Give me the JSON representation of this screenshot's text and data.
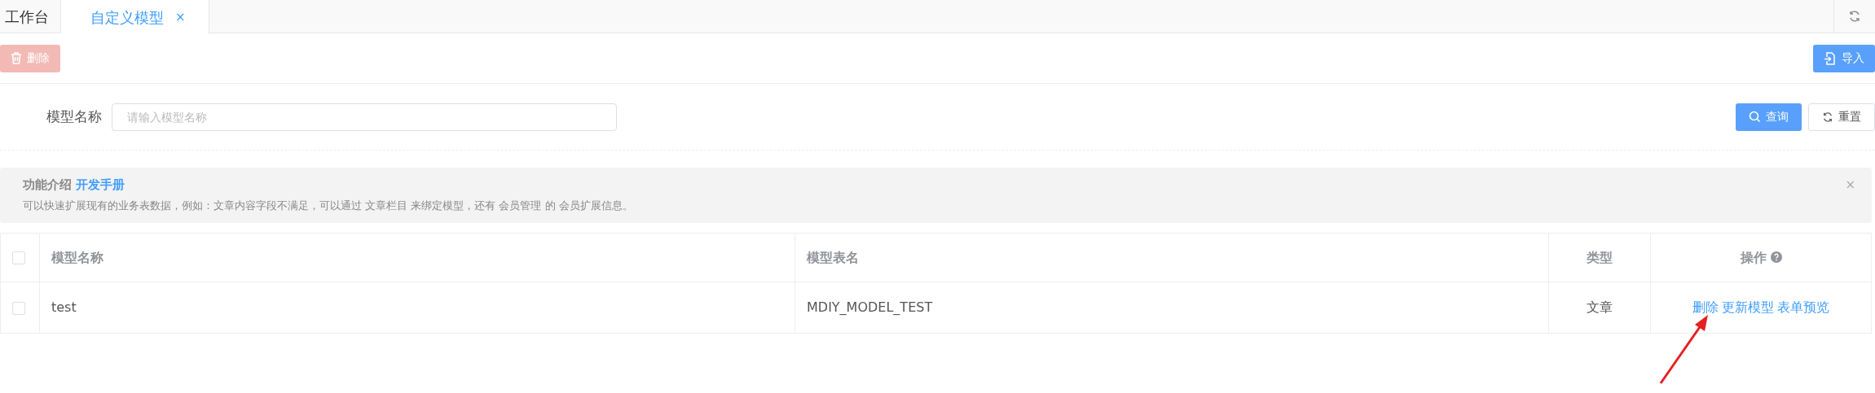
{
  "tabs": [
    {
      "label": "工作台",
      "selected": false
    },
    {
      "label": "自定义模型",
      "selected": true,
      "close": "×"
    }
  ],
  "toolbar": {
    "delete_button": {
      "label": "删除",
      "disabled": true
    },
    "import_button": {
      "label": "导入"
    }
  },
  "search": {
    "label": "模型名称",
    "placeholder": "请输入模型名称",
    "query_button": "查询",
    "reset_button": "重置"
  },
  "notice": {
    "close": "×",
    "title": "功能介绍",
    "link": "开发手册",
    "text": "可以快速扩展现有的业务表数据，例如：文章内容字段不满足，可以通过 文章栏目 来绑定模型，还有 会员管理 的 会员扩展信息。"
  },
  "table": {
    "columns": [
      "模型名称",
      "模型表名",
      "类型",
      "操作"
    ],
    "all_checked": false,
    "rows": [
      {
        "checked": false,
        "name": "test",
        "table_name": "MDIY_MODEL_TEST",
        "type": "文章",
        "actions": [
          "删除",
          "更新模型",
          "表单预览"
        ]
      }
    ]
  }
}
